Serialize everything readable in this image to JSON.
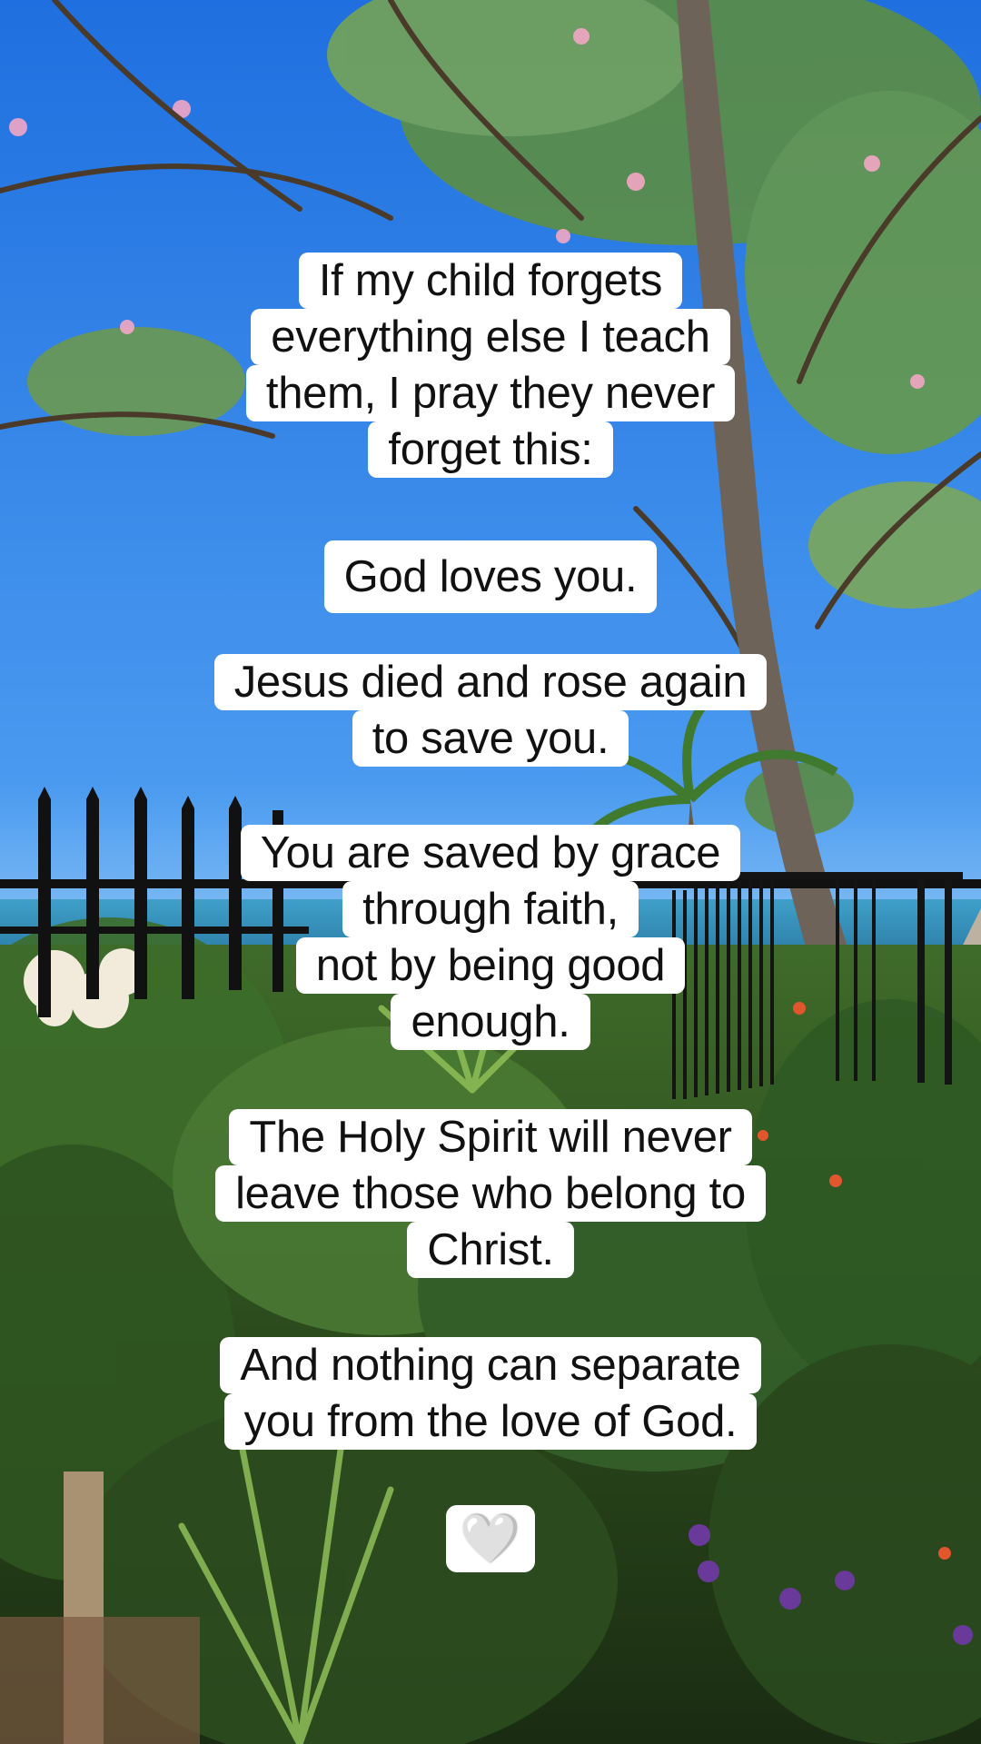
{
  "captions": {
    "block1": {
      "line1": "If my child forgets",
      "line2": "everything else I teach",
      "line3": "them, I pray they never",
      "line4": "forget this:"
    },
    "block2": {
      "line1": "God loves you."
    },
    "block3": {
      "line1": "Jesus died and rose again",
      "line2": "to save you."
    },
    "block4": {
      "line1": "You are saved by grace",
      "line2": "through faith,",
      "line3": "not by being good",
      "line4": "enough."
    },
    "block5": {
      "line1": "The Holy Spirit will never",
      "line2": "leave those who belong to",
      "line3": "Christ."
    },
    "block6": {
      "line1": "And nothing can separate",
      "line2": "you from the love of God."
    },
    "heart": {
      "glyph": "🤍",
      "icon": "white-heart-icon"
    }
  },
  "colors": {
    "sky": "#3a86e8",
    "caption_bg": "#ffffff",
    "caption_text": "#111111"
  }
}
